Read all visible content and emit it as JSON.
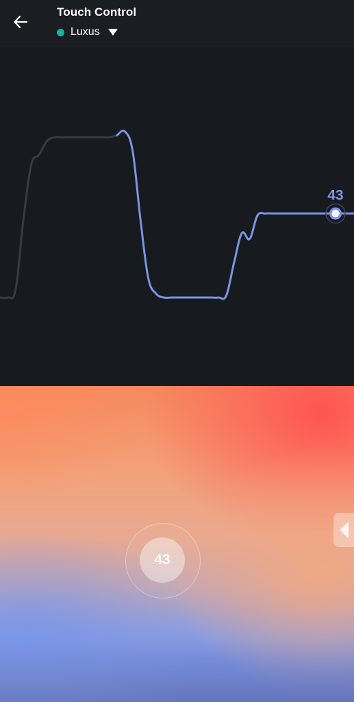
{
  "header": {
    "title": "Touch Control",
    "device": {
      "name": "Luxus",
      "status_color": "#16b39f"
    },
    "back_icon": "arrow-left-icon",
    "dropdown_icon": "caret-down-icon"
  },
  "chart_data": {
    "type": "line",
    "title": "",
    "xlabel": "",
    "ylabel": "",
    "ylim": [
      0,
      100
    ],
    "grid": false,
    "current_value_label": "43",
    "series": [
      {
        "values": [
          0,
          0,
          4,
          40,
          68,
          73,
          80,
          82,
          82,
          82,
          82,
          82,
          82,
          82,
          82,
          83,
          85,
          75,
          40,
          10,
          2,
          0,
          0,
          0,
          0,
          0,
          0,
          0,
          0,
          1,
          18,
          33,
          30,
          42,
          43,
          43,
          43,
          43,
          43,
          43,
          43,
          43,
          43,
          43
        ]
      }
    ],
    "colors": {
      "recent_line": "#7d95e4",
      "faded_line": "#363b46",
      "background": "#171a1f"
    }
  },
  "touchpad": {
    "intensity_value": "43",
    "side_tab_icon": "chevron-left-icon"
  }
}
